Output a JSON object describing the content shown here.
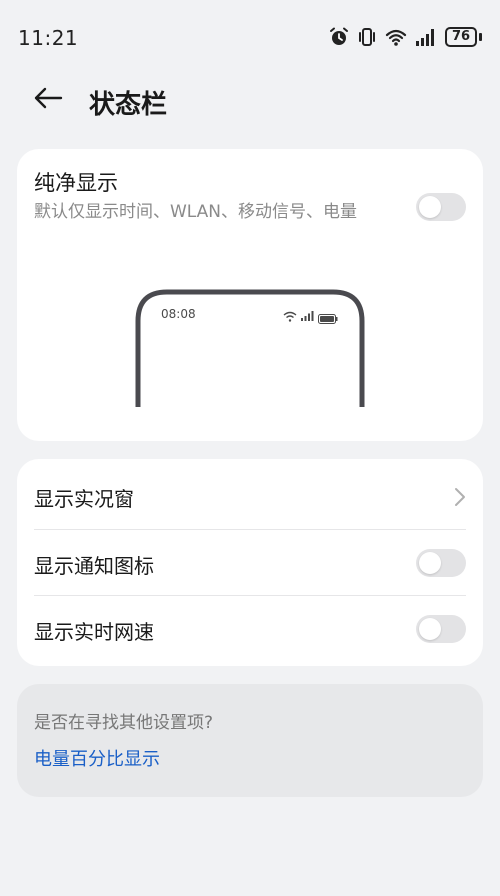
{
  "status_bar": {
    "time": "11:21",
    "battery": "76",
    "icons": [
      "alarm-icon",
      "vibrate-icon",
      "wifi-icon",
      "signal-icon",
      "battery-icon"
    ]
  },
  "header": {
    "back_icon": "back-arrow-icon",
    "title": "状态栏"
  },
  "pure_display": {
    "title": "纯净显示",
    "description": "默认仅显示时间、WLAN、移动信号、电量",
    "toggle_on": false,
    "preview_time": "08:08"
  },
  "settings": [
    {
      "label": "显示实况窗",
      "control": "chevron"
    },
    {
      "label": "显示通知图标",
      "control": "toggle",
      "on": false
    },
    {
      "label": "显示实时网速",
      "control": "toggle",
      "on": false
    }
  ],
  "search_suggest": {
    "question": "是否在寻找其他设置项?",
    "link": "电量百分比显示"
  },
  "colors": {
    "background": "#f1f2f4",
    "card": "#ffffff",
    "link": "#1a5fc7",
    "toggle_off": "#e3e3e5",
    "phone_frame": "#4a4a4f"
  }
}
